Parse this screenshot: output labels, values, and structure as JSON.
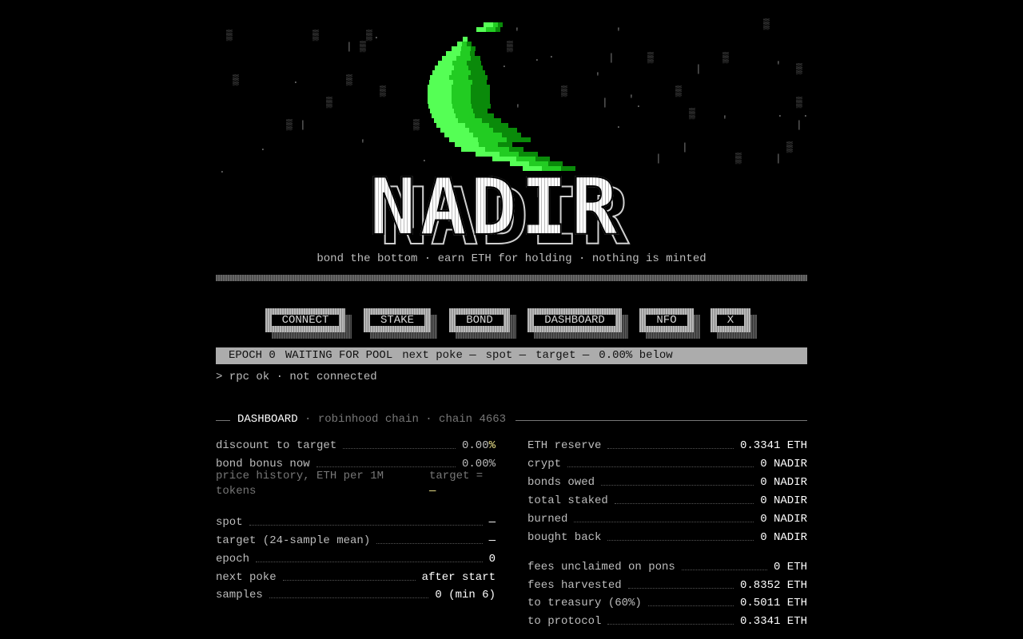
{
  "brand": {
    "name": "NADIR",
    "tagline": "bond the bottom · earn ETH for holding · nothing is minted"
  },
  "nav": [
    {
      "label": "CONNECT"
    },
    {
      "label": "STAKE"
    },
    {
      "label": "BOND"
    },
    {
      "label": "DASHBOARD"
    },
    {
      "label": "NFO"
    },
    {
      "label": "X"
    }
  ],
  "status": {
    "epoch": "EPOCH 0",
    "state": "WAITING FOR POOL",
    "next_poke": "next poke —",
    "spot": "spot —",
    "target": "target —",
    "below": "0.00% below"
  },
  "rpc": "> rpc ok · not connected",
  "section": {
    "title": "DASHBOARD",
    "subtitle": "· robinhood chain · chain 4663"
  },
  "left": {
    "discount": {
      "label": "discount to target",
      "value": "0.00",
      "unit": "%"
    },
    "bonus": {
      "label": "bond bonus now",
      "value": "0.00",
      "unit": "%"
    },
    "history_label": "price history, ETH per 1M tokens",
    "history_target": "target =",
    "history_target_value": "—",
    "rows": [
      {
        "label": "spot",
        "value": "—"
      },
      {
        "label": "target (24-sample mean)",
        "value": "—"
      },
      {
        "label": "epoch",
        "value": "0"
      },
      {
        "label": "next poke",
        "value": "after start"
      },
      {
        "label": "samples",
        "value": "0 (min 6)"
      }
    ]
  },
  "right": {
    "rows": [
      {
        "label": "ETH reserve",
        "value": "0.3341 ETH"
      },
      {
        "label": "crypt",
        "value": "0 NADIR"
      },
      {
        "label": "bonds owed",
        "value": "0 NADIR"
      },
      {
        "label": "total staked",
        "value": "0 NADIR"
      },
      {
        "label": "burned",
        "value": "0 NADIR"
      },
      {
        "label": "bought back",
        "value": "0 NADIR"
      }
    ],
    "fees": [
      {
        "label": "fees unclaimed on pons",
        "value": "0 ETH"
      },
      {
        "label": "fees harvested",
        "value": "0.8352 ETH"
      },
      {
        "label": "to treasury (60%)",
        "value": "0.5011 ETH"
      },
      {
        "label": "to protocol",
        "value": "0.3341 ETH"
      }
    ]
  },
  "colors": {
    "moon_light": "#55ff55",
    "moon_mid": "#22cc22",
    "moon_dark": "#0a8a0a",
    "accent_yellow": "#f0e68c",
    "status_bg": "#acacac"
  }
}
